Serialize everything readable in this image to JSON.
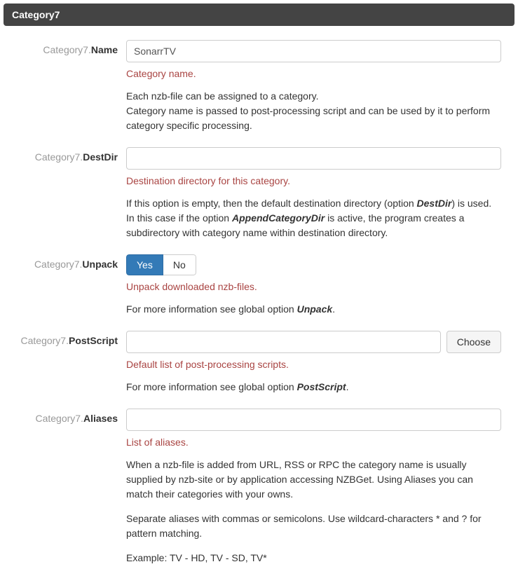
{
  "section": {
    "title": "Category7"
  },
  "fields": {
    "name": {
      "prefix": "Category7.",
      "label": "Name",
      "value": "SonarrTV",
      "hint": "Category name.",
      "desc": "Each nzb-file can be assigned to a category.\nCategory name is passed to post-processing script and can be used by it to perform category specific processing."
    },
    "destdir": {
      "prefix": "Category7.",
      "label": "DestDir",
      "value": "",
      "hint": "Destination directory for this category.",
      "desc_pre": "If this option is empty, then the default destination directory (option ",
      "desc_em1": "DestDir",
      "desc_mid": ") is used. In this case if the option ",
      "desc_em2": "AppendCategoryDir",
      "desc_post": " is active, the program creates a subdirectory with category name within destination directory."
    },
    "unpack": {
      "prefix": "Category7.",
      "label": "Unpack",
      "options": {
        "yes": "Yes",
        "no": "No"
      },
      "value": "yes",
      "hint": "Unpack downloaded nzb-files.",
      "desc_pre": "For more information see global option ",
      "desc_em": "Unpack",
      "desc_post": "."
    },
    "postscript": {
      "prefix": "Category7.",
      "label": "PostScript",
      "value": "",
      "choose": "Choose",
      "hint": "Default list of post-processing scripts.",
      "desc_pre": "For more information see global option ",
      "desc_em": "PostScript",
      "desc_post": "."
    },
    "aliases": {
      "prefix": "Category7.",
      "label": "Aliases",
      "value": "",
      "hint": "List of aliases.",
      "desc1": "When a nzb-file is added from URL, RSS or RPC the category name is usually supplied by nzb-site or by application accessing NZBGet. Using Aliases you can match their categories with your owns.",
      "desc2": "Separate aliases with commas or semicolons. Use wildcard-characters * and ? for pattern matching.",
      "desc3": "Example: TV - HD, TV - SD, TV*"
    }
  }
}
